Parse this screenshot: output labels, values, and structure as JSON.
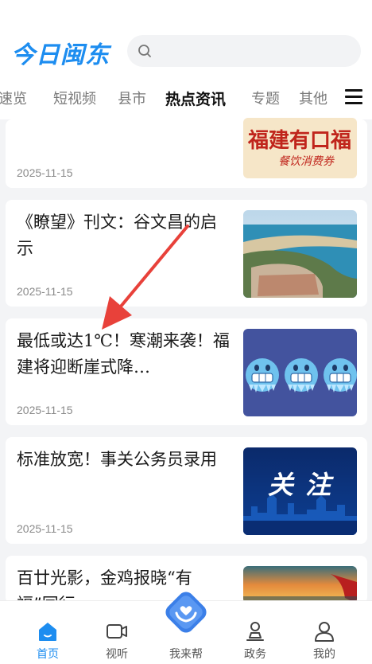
{
  "app": {
    "logo_text": "今日闽东"
  },
  "search": {
    "placeholder": ""
  },
  "tabs": [
    {
      "label": "闽速览"
    },
    {
      "label": "短视频"
    },
    {
      "label": "县市"
    },
    {
      "label": "热点资讯",
      "active": true
    },
    {
      "label": "专题"
    },
    {
      "label": "其他"
    }
  ],
  "articles": [
    {
      "title": "",
      "date": "2025-11-15",
      "thumb_text": "福建有口福",
      "thumb_sub": "餐饮消费券"
    },
    {
      "title": "《瞭望》刊文：谷文昌的启示",
      "date": "2025-11-15"
    },
    {
      "title": "最低或达1℃！寒潮来袭！福建将迎断崖式降…",
      "date": "2025-11-15"
    },
    {
      "title": "标准放宽！事关公务员录用",
      "date": "2025-11-15",
      "thumb_text": "关 注"
    },
    {
      "title": "百廿光影，金鸡报晓“有福”同行",
      "date": ""
    }
  ],
  "bottom_nav": [
    {
      "label": "首页",
      "icon": "home-icon",
      "active": true
    },
    {
      "label": "视听",
      "icon": "video-icon"
    },
    {
      "label": "我来帮",
      "icon": "help-hands-icon"
    },
    {
      "label": "政务",
      "icon": "government-icon"
    },
    {
      "label": "我的",
      "icon": "profile-icon"
    }
  ],
  "colors": {
    "accent": "#1d8df0",
    "annotation_arrow": "#e8413a"
  }
}
